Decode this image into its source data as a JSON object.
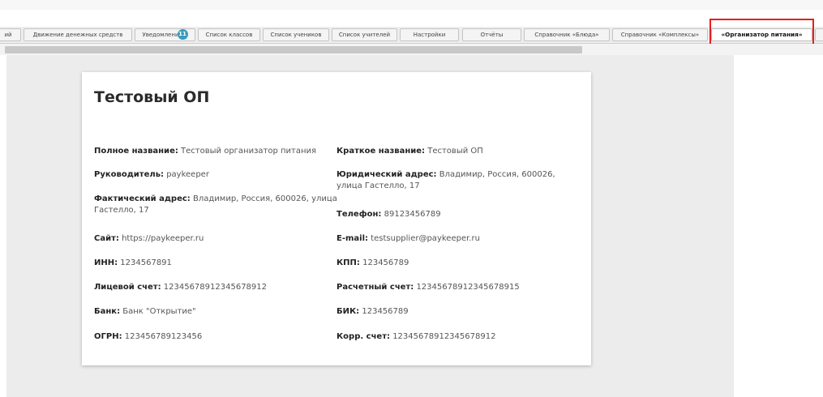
{
  "tabs": [
    {
      "label": "ий"
    },
    {
      "label": "Движение денежных средств"
    },
    {
      "label": "Уведомлени",
      "badge": "11"
    },
    {
      "label": "Список классов"
    },
    {
      "label": "Список учеников"
    },
    {
      "label": "Список учителей"
    },
    {
      "label": "Настройки"
    },
    {
      "label": "Отчёты"
    },
    {
      "label": "Справочник «Блюда»"
    },
    {
      "label": "Справочник «Комплексы»"
    },
    {
      "label": "«Организатор питания»"
    }
  ],
  "card": {
    "title": "Тестовый ОП",
    "fields": [
      {
        "label": "Полное название:",
        "value": " Тестовый организатор питания"
      },
      {
        "label": "Краткое название:",
        "value": " Тестовый ОП"
      },
      {
        "label": "Руководитель:",
        "value": " paykeeper"
      },
      {
        "label": "Юридический адрес:",
        "value": " Владимир, Россия, 600026, улица Гастелло, 17"
      },
      {
        "label": "Фактический адрес:",
        "value": " Владимир, Россия, 600026, улица Гастелло, 17"
      },
      {
        "label": "Телефон:",
        "value": " 89123456789"
      },
      {
        "label": "Сайт:",
        "value": " https://paykeeper.ru"
      },
      {
        "label": "E-mail:",
        "value": " testsupplier@paykeeper.ru"
      },
      {
        "label": "ИНН:",
        "value": " 1234567891"
      },
      {
        "label": "КПП:",
        "value": " 123456789"
      },
      {
        "label": "Лицевой счет:",
        "value": " 12345678912345678912"
      },
      {
        "label": "Расчетный счет:",
        "value": " 12345678912345678915"
      },
      {
        "label": "Банк:",
        "value": " Банк \"Открытие\""
      },
      {
        "label": "БИК:",
        "value": " 123456789"
      },
      {
        "label": "ОГРН:",
        "value": " 123456789123456"
      },
      {
        "label": "Корр. счет:",
        "value": " 12345678912345678912"
      }
    ]
  },
  "colors": {
    "highlight": "#e61e1e",
    "badge": "#3a9bbd"
  }
}
